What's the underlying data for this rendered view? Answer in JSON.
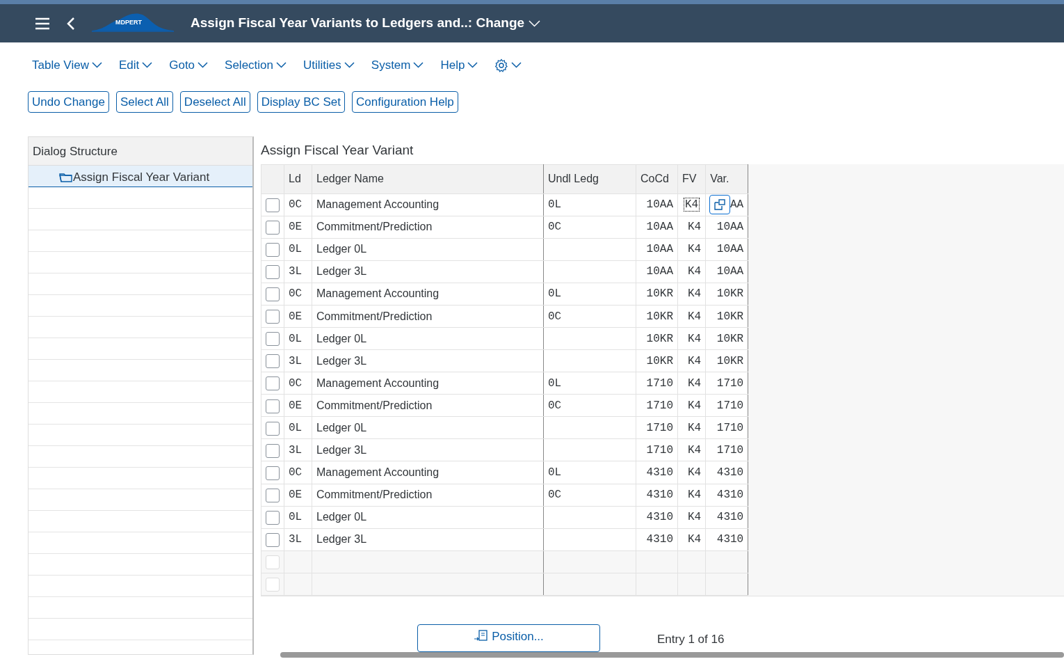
{
  "header": {
    "logo_text": "MDPERT",
    "title": "Assign Fiscal Year Variants to Ledgers and..: Change"
  },
  "menu": [
    "Table View",
    "Edit",
    "Goto",
    "Selection",
    "Utilities",
    "System",
    "Help"
  ],
  "buttons": [
    "Undo Change",
    "Select All",
    "Deselect All",
    "Display BC Set",
    "Configuration Help"
  ],
  "dialog_structure": {
    "title": "Dialog Structure",
    "items": [
      {
        "label": "Assign Fiscal Year Variant",
        "selected": true
      }
    ]
  },
  "table": {
    "title": "Assign Fiscal Year Variant",
    "columns": [
      "Ld",
      "Ledger Name",
      "Undl Ledg",
      "CoCd",
      "FV",
      "Var."
    ],
    "rows": [
      {
        "kind": "entry",
        "checked": false,
        "focused": true,
        "popup": true,
        "cells": [
          "0C",
          "Management Accounting",
          "0L",
          "10AA",
          "K4",
          "AA"
        ]
      },
      {
        "kind": "entry",
        "checked": false,
        "focused": false,
        "popup": false,
        "cells": [
          "0E",
          "Commitment/Prediction",
          "0C",
          "10AA",
          "K4",
          "10AA"
        ]
      },
      {
        "kind": "entry",
        "checked": false,
        "focused": false,
        "popup": false,
        "cells": [
          "0L",
          "Ledger 0L",
          "",
          "10AA",
          "K4",
          "10AA"
        ]
      },
      {
        "kind": "entry",
        "checked": false,
        "focused": false,
        "popup": false,
        "cells": [
          "3L",
          "Ledger 3L",
          "",
          "10AA",
          "K4",
          "10AA"
        ]
      },
      {
        "kind": "entry",
        "checked": false,
        "focused": false,
        "popup": false,
        "cells": [
          "0C",
          "Management Accounting",
          "0L",
          "10KR",
          "K4",
          "10KR"
        ]
      },
      {
        "kind": "entry",
        "checked": false,
        "focused": false,
        "popup": false,
        "cells": [
          "0E",
          "Commitment/Prediction",
          "0C",
          "10KR",
          "K4",
          "10KR"
        ]
      },
      {
        "kind": "entry",
        "checked": false,
        "focused": false,
        "popup": false,
        "cells": [
          "0L",
          "Ledger 0L",
          "",
          "10KR",
          "K4",
          "10KR"
        ]
      },
      {
        "kind": "entry",
        "checked": false,
        "focused": false,
        "popup": false,
        "cells": [
          "3L",
          "Ledger 3L",
          "",
          "10KR",
          "K4",
          "10KR"
        ]
      },
      {
        "kind": "entry",
        "checked": false,
        "focused": false,
        "popup": false,
        "cells": [
          "0C",
          "Management Accounting",
          "0L",
          "1710",
          "K4",
          "1710"
        ]
      },
      {
        "kind": "entry",
        "checked": false,
        "focused": false,
        "popup": false,
        "cells": [
          "0E",
          "Commitment/Prediction",
          "0C",
          "1710",
          "K4",
          "1710"
        ]
      },
      {
        "kind": "entry",
        "checked": false,
        "focused": false,
        "popup": false,
        "cells": [
          "0L",
          "Ledger 0L",
          "",
          "1710",
          "K4",
          "1710"
        ]
      },
      {
        "kind": "entry",
        "checked": false,
        "focused": false,
        "popup": false,
        "cells": [
          "3L",
          "Ledger 3L",
          "",
          "1710",
          "K4",
          "1710"
        ]
      },
      {
        "kind": "entry",
        "checked": false,
        "focused": false,
        "popup": false,
        "cells": [
          "0C",
          "Management Accounting",
          "0L",
          "4310",
          "K4",
          "4310"
        ]
      },
      {
        "kind": "entry",
        "checked": false,
        "focused": false,
        "popup": false,
        "cells": [
          "0E",
          "Commitment/Prediction",
          "0C",
          "4310",
          "K4",
          "4310"
        ]
      },
      {
        "kind": "entry",
        "checked": false,
        "focused": false,
        "popup": false,
        "cells": [
          "0L",
          "Ledger 0L",
          "",
          "4310",
          "K4",
          "4310"
        ]
      },
      {
        "kind": "entry",
        "checked": false,
        "focused": false,
        "popup": false,
        "cells": [
          "3L",
          "Ledger 3L",
          "",
          "4310",
          "K4",
          "4310"
        ]
      },
      {
        "kind": "blank",
        "checked": false,
        "disabled": true
      },
      {
        "kind": "blank",
        "checked": false,
        "disabled": true
      }
    ]
  },
  "footer": {
    "position_button": "Position...",
    "entry_text": "Entry 1 of 16"
  }
}
